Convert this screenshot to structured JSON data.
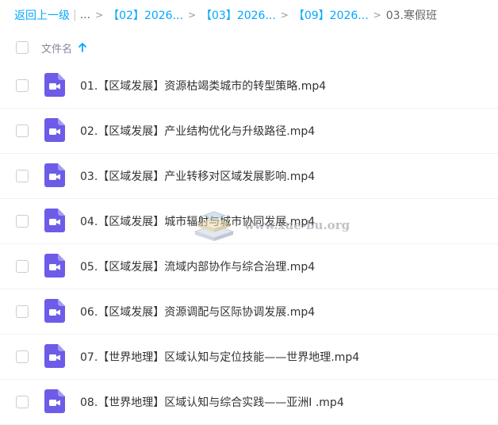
{
  "breadcrumb": {
    "back": "返回上一级",
    "separator": "|",
    "ellipsis": "...",
    "arrow": ">",
    "crumbs": [
      "【02】2026...",
      "【03】2026...",
      "【09】2026..."
    ],
    "current": "03.寒假班"
  },
  "list_header": {
    "column_name": "文件名",
    "sort": "ascending"
  },
  "files": [
    {
      "name": "01.【区域发展】资源枯竭类城市的转型策略.mp4"
    },
    {
      "name": "02.【区域发展】产业结构优化与升级路径.mp4"
    },
    {
      "name": "03.【区域发展】产业转移对区域发展影响.mp4"
    },
    {
      "name": "04.【区域发展】城市辐射与城市协同发展.mp4"
    },
    {
      "name": "05.【区域发展】流域内部协作与综合治理.mp4"
    },
    {
      "name": "06.【区域发展】资源调配与区际协调发展.mp4"
    },
    {
      "name": "07.【世界地理】区域认知与定位技能——世界地理.mp4"
    },
    {
      "name": "08.【世界地理】区域认知与综合实践——亚洲I .mp4"
    }
  ],
  "watermark": {
    "text": "www.xue-bu.org",
    "icon": "book-stack-icon"
  },
  "colors": {
    "link": "#06a7ff",
    "video_icon": "#6c5ce7",
    "row_divider": "#f1f2f4"
  },
  "icons": {
    "file_type": "video-file-icon",
    "sort": "sort-up-arrow-icon"
  }
}
